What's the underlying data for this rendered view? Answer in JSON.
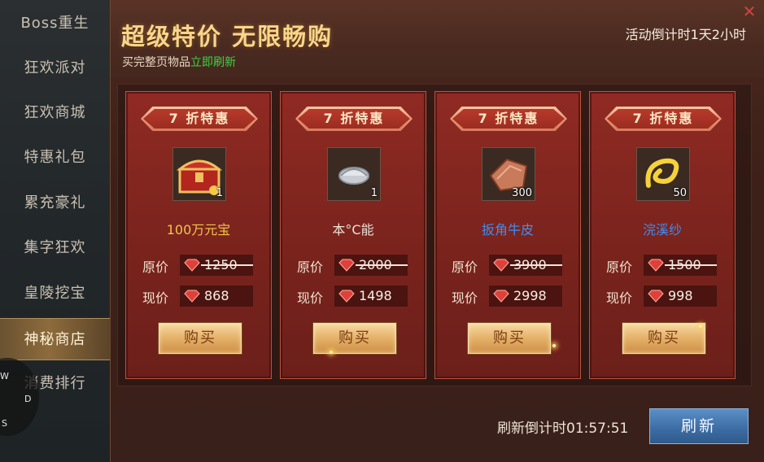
{
  "sidebar": {
    "items": [
      {
        "label": "Boss重生"
      },
      {
        "label": "狂欢派对"
      },
      {
        "label": "狂欢商城"
      },
      {
        "label": "特惠礼包"
      },
      {
        "label": "累充豪礼"
      },
      {
        "label": "集字狂欢"
      },
      {
        "label": "皇陵挖宝"
      },
      {
        "label": "神秘商店",
        "active": true
      },
      {
        "label": "消费排行"
      }
    ]
  },
  "compass": {
    "w": "W",
    "d": "D",
    "s": "S"
  },
  "header": {
    "title": "超级特价 无限畅购",
    "subtitle_prefix": "买完整页物品",
    "subtitle_highlight": "立即刷新",
    "countdown": "活动倒计时1天2小时"
  },
  "labels": {
    "original_price": "原价",
    "current_price": "现价",
    "buy": "购买"
  },
  "cards": [
    {
      "discount": "7 折特惠",
      "item_name": "100万元宝",
      "qty": "1",
      "icon": "treasure-chest-icon",
      "original_price": "1250",
      "current_price": "868",
      "name_color": "gold"
    },
    {
      "discount": "7 折特惠",
      "item_name": "本°C能",
      "qty": "1",
      "icon": "silver-shell-icon",
      "original_price": "2000",
      "current_price": "1498",
      "name_color": "white"
    },
    {
      "discount": "7 折特惠",
      "item_name": "扳角牛皮",
      "qty": "300",
      "icon": "ox-hide-icon",
      "original_price": "3900",
      "current_price": "2998",
      "name_color": "blue"
    },
    {
      "discount": "7 折特惠",
      "item_name": "浣溪纱",
      "qty": "50",
      "icon": "golden-silk-icon",
      "original_price": "1500",
      "current_price": "998",
      "name_color": "blue"
    }
  ],
  "footer": {
    "refresh_timer": "刷新倒计时01:57:51",
    "refresh_button": "刷新"
  },
  "colors": {
    "accent_gold": "#f7d68a",
    "highlight_green": "#37d742",
    "rare_blue": "#3f8ef0",
    "card_red": "#8f2a23"
  }
}
